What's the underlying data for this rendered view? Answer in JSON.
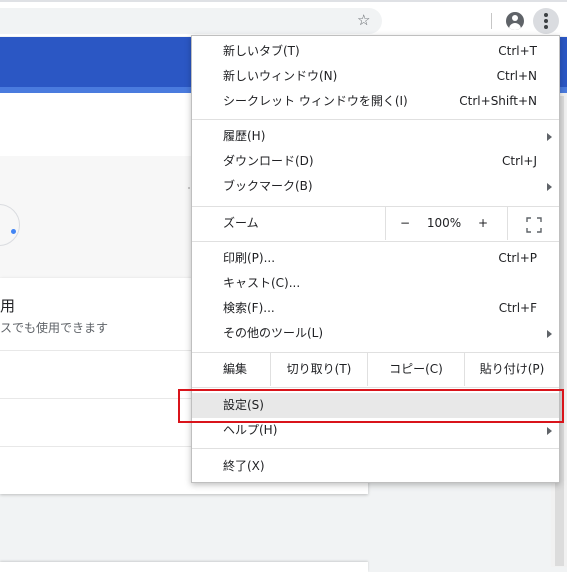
{
  "page": {
    "title_partial": "用",
    "subtitle_partial": "スでも使用できます"
  },
  "menu": {
    "new_tab": {
      "label": "新しいタブ(T)",
      "shortcut": "Ctrl+T"
    },
    "new_window": {
      "label": "新しいウィンドウ(N)",
      "shortcut": "Ctrl+N"
    },
    "incognito": {
      "label": "シークレット ウィンドウを開く(I)",
      "shortcut": "Ctrl+Shift+N"
    },
    "history": {
      "label": "履歴(H)"
    },
    "downloads": {
      "label": "ダウンロード(D)",
      "shortcut": "Ctrl+J"
    },
    "bookmarks": {
      "label": "ブックマーク(B)"
    },
    "zoom": {
      "label": "ズーム",
      "minus": "−",
      "value": "100%",
      "plus": "+"
    },
    "print": {
      "label": "印刷(P)...",
      "shortcut": "Ctrl+P"
    },
    "cast": {
      "label": "キャスト(C)..."
    },
    "find": {
      "label": "検索(F)...",
      "shortcut": "Ctrl+F"
    },
    "more_tools": {
      "label": "その他のツール(L)"
    },
    "edit": {
      "label": "編集",
      "cut": "切り取り(T)",
      "copy": "コピー(C)",
      "paste": "貼り付け(P)"
    },
    "settings": {
      "label": "設定(S)"
    },
    "help": {
      "label": "ヘルプ(H)"
    },
    "exit": {
      "label": "終了(X)"
    }
  },
  "icons": {
    "star": "star-icon",
    "profile": "account-circle-icon",
    "menu": "more-vertical-icon",
    "fullscreen": "fullscreen-icon",
    "submenu": "chevron-right-icon"
  },
  "colors": {
    "banner": "#2b57c4",
    "highlight_border": "#d9141b",
    "accent_dot": "#4285f4"
  }
}
